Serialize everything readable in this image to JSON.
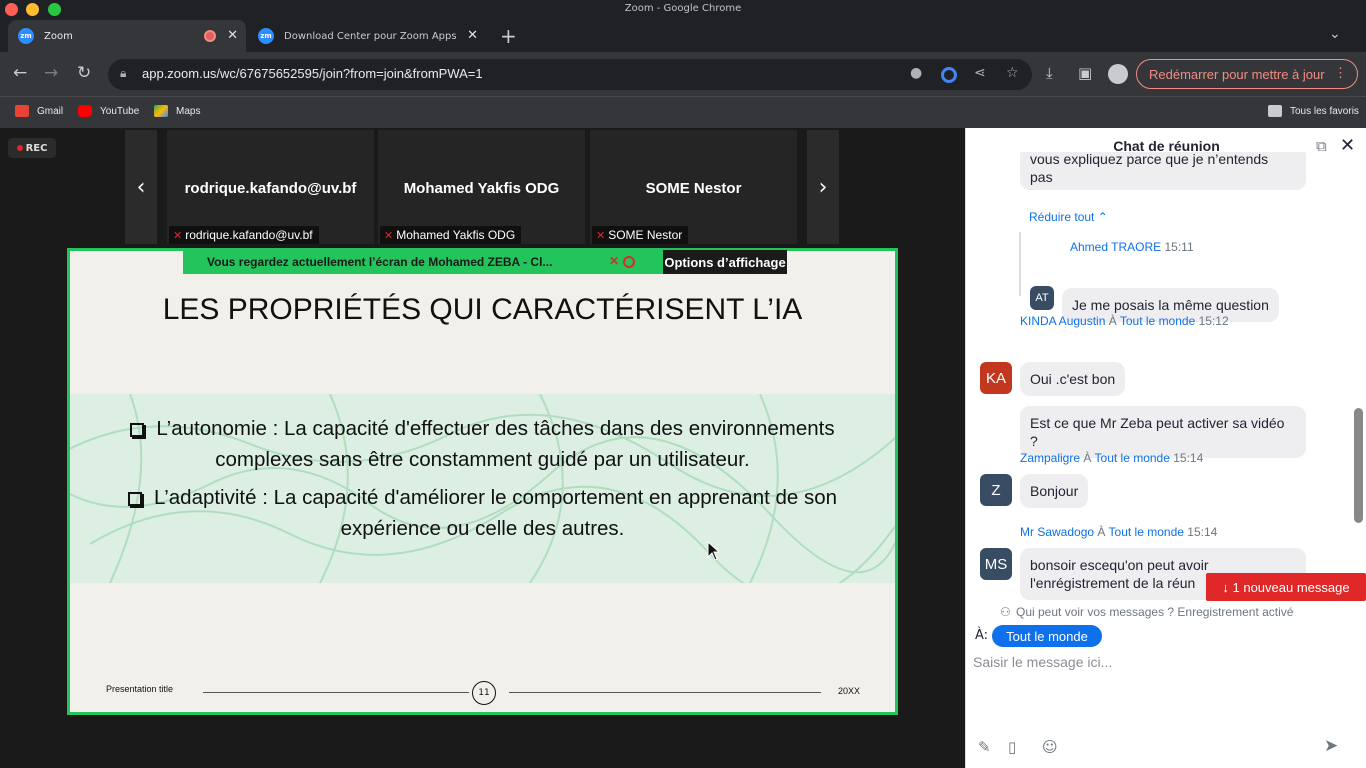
{
  "window": {
    "title": "Zoom - Google Chrome"
  },
  "tabs": [
    {
      "title": "Zoom",
      "favicon": "zm"
    },
    {
      "title": "Download Center pour Zoom Apps et modules",
      "favicon": "zm"
    }
  ],
  "address_bar": {
    "url": "app.zoom.us/wc/67675652595/join?from=join&fromPWA=1"
  },
  "toolbar": {
    "relaunch_label": "Redémarrer pour mettre à jour"
  },
  "bookmarks": [
    {
      "label": "Gmail"
    },
    {
      "label": "YouTube"
    },
    {
      "label": "Maps"
    }
  ],
  "bookmarks_all": "Tous les favoris",
  "meeting": {
    "rec_label": "REC",
    "participants": [
      {
        "name": "rodrique.kafando@uv.bf",
        "footer": "rodrique.kafando@uv.bf"
      },
      {
        "name": "Mohamed Yakfis ODG",
        "footer": "Mohamed Yakfis ODG"
      },
      {
        "name": "SOME Nestor",
        "footer": "SOME Nestor"
      }
    ],
    "share_banner": "Vous regardez actuellement l’écran de  Mohamed ZEBA - Cl...",
    "view_options": "Options d’affichage",
    "slide": {
      "title": "LES PROPRIÉTÉS QUI CARACTÉRISENT L’IA",
      "bullet1_line1": "L’autonomie : La capacité d'effectuer des tâches dans des environnements",
      "bullet1_line2": "complexes sans être constamment guidé par un utilisateur.",
      "bullet2_line1": "L’adaptivité : La capacité d'améliorer le comportement en apprenant de son",
      "bullet2_line2": "expérience ou celle des autres.",
      "footer_title": "Presentation title",
      "page_number": "11",
      "year": "20XX"
    }
  },
  "chat": {
    "title": "Chat de réunion",
    "partial_message_line1": "vous expliquez parce que je n’entends",
    "partial_message_line2": "pas",
    "collapse_label": "Réduire tout",
    "messages": [
      {
        "sender": "Ahmed TRAORE",
        "time": "15:11",
        "initials": "AT",
        "text": "Je me posais la même question"
      },
      {
        "sender": "KINDA Augustin",
        "to_word": "À",
        "to": "Tout le monde",
        "time": "15:12",
        "initials": "KA",
        "text": "Oui .c'est bon",
        "text2_line1": "Est ce que Mr Zeba peut activer sa vidéo",
        "text2_line2": "?"
      },
      {
        "sender": "Zampaligre",
        "to_word": "À",
        "to": "Tout le monde",
        "time": "15:14",
        "initials": "Z",
        "text": "Bonjour"
      },
      {
        "sender": "Mr Sawadogo",
        "to_word": "À",
        "to": "Tout le monde",
        "time": "15:14",
        "initials": "MS",
        "text_line1": "bonsoir escequ'on peut avoir",
        "text_line2": "l'enrégistrement de la réun"
      }
    ],
    "new_message_badge": "↓ 1 nouveau message",
    "privacy_text": "Qui peut voir vos messages ? Enregistrement activé",
    "to_label": "À:",
    "to_value": "Tout le monde",
    "input_placeholder": "Saisir le message ici..."
  },
  "colors": {
    "share_border": "#23c45c",
    "accent": "#0e71eb",
    "alert": "#e02828"
  }
}
